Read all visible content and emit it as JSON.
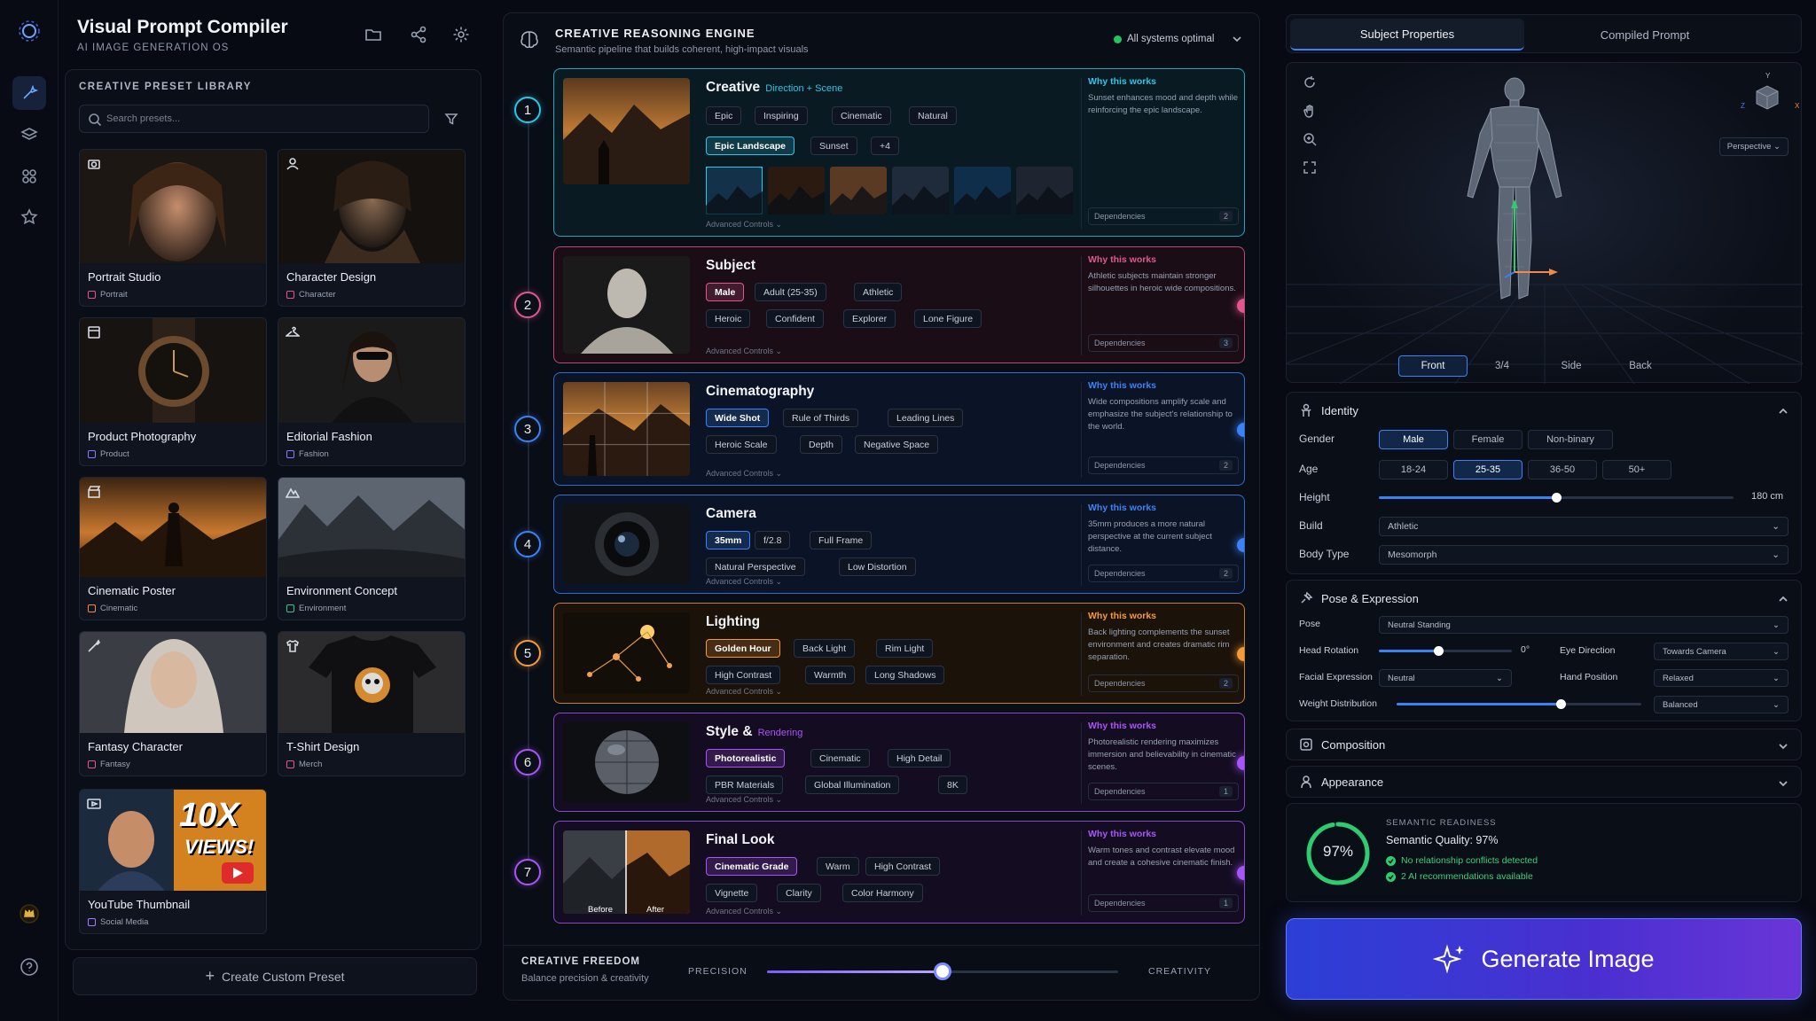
{
  "app": {
    "title": "Visual Prompt Compiler",
    "subtitle": "AI IMAGE GENERATION OS"
  },
  "library": {
    "title": "CREATIVE PRESET LIBRARY",
    "search_placeholder": "Search presets...",
    "create_label": "Create Custom Preset",
    "cards": [
      {
        "name": "Portrait Studio",
        "tag": "Portrait",
        "icon": "camera-icon",
        "tag_color": "#e0578f"
      },
      {
        "name": "Character Design",
        "tag": "Character",
        "icon": "user-icon",
        "tag_color": "#e0578f"
      },
      {
        "name": "Product Photography",
        "tag": "Product",
        "icon": "box-icon",
        "tag_color": "#8b7bff"
      },
      {
        "name": "Editorial Fashion",
        "tag": "Fashion",
        "icon": "hanger-icon",
        "tag_color": "#8b7bff"
      },
      {
        "name": "Cinematic Poster",
        "tag": "Cinematic",
        "icon": "clapper-icon",
        "tag_color": "#f08a4b"
      },
      {
        "name": "Environment Concept",
        "tag": "Environment",
        "icon": "mountain-icon",
        "tag_color": "#34c38f"
      },
      {
        "name": "Fantasy Character",
        "tag": "Fantasy",
        "icon": "wand-icon",
        "tag_color": "#e0578f"
      },
      {
        "name": "T-Shirt Design",
        "tag": "Merch",
        "icon": "shirt-icon",
        "tag_color": "#e0578f"
      },
      {
        "name": "YouTube Thumbnail",
        "tag": "Social Media",
        "icon": "play-icon",
        "tag_color": "#a77bff",
        "overlay1": "10X",
        "overlay2": "VIEWS!"
      }
    ]
  },
  "engine": {
    "title": "CREATIVE REASONING ENGINE",
    "subtitle": "Semantic pipeline that builds coherent, high-impact visuals",
    "status": "All systems optimal",
    "steps": [
      {
        "num": "1",
        "title": "Creative",
        "accent": "Direction + Scene",
        "color": "#2cc6e6",
        "chips_r1": [
          "Epic",
          "Inspiring",
          "Cinematic",
          "Natural"
        ],
        "chips_r2": [
          "Epic Landscape",
          "Sunset",
          "+4"
        ],
        "why_title": "Why this works",
        "why": "Sunset enhances mood and depth while reinforcing the epic landscape.",
        "deps_label": "Dependencies",
        "deps": "2",
        "adv": "Advanced Controls"
      },
      {
        "num": "2",
        "title": "Subject",
        "accent": "",
        "color": "#e0578f",
        "chips_r1": [
          "Male",
          "Adult (25-35)",
          "Athletic"
        ],
        "chips_r2": [
          "Heroic",
          "Confident",
          "Explorer",
          "Lone Figure"
        ],
        "why_title": "Why this works",
        "why": "Athletic subjects maintain stronger silhouettes in heroic wide compositions.",
        "deps_label": "Dependencies",
        "deps": "3",
        "adv": "Advanced Controls"
      },
      {
        "num": "3",
        "title": "Cinematography",
        "accent": "",
        "color": "#3b82f6",
        "chips_r1": [
          "Wide Shot",
          "Rule of Thirds",
          "Leading Lines"
        ],
        "chips_r2": [
          "Heroic Scale",
          "Depth",
          "Negative Space"
        ],
        "why_title": "Why this works",
        "why": "Wide compositions amplify scale and emphasize the subject's relationship to the world.",
        "deps_label": "Dependencies",
        "deps": "2",
        "adv": "Advanced Controls"
      },
      {
        "num": "4",
        "title": "Camera",
        "accent": "",
        "color": "#3b82f6",
        "chips_r1": [
          "35mm",
          "f/2.8",
          "Full Frame"
        ],
        "chips_r2": [
          "Natural Perspective",
          "Low Distortion"
        ],
        "why_title": "Why this works",
        "why": "35mm produces a more natural perspective at the current subject distance.",
        "deps_label": "Dependencies",
        "deps": "2",
        "adv": "Advanced Controls"
      },
      {
        "num": "5",
        "title": "Lighting",
        "accent": "",
        "color": "#f39a3b",
        "chips_r1": [
          "Golden Hour",
          "Back Light",
          "Rim Light"
        ],
        "chips_r2": [
          "High Contrast",
          "Warmth",
          "Long Shadows"
        ],
        "why_title": "Why this works",
        "why": "Back lighting complements the sunset environment and creates dramatic rim separation.",
        "deps_label": "Dependencies",
        "deps": "2",
        "adv": "Advanced Controls"
      },
      {
        "num": "6",
        "title": "Style &",
        "accent": "Rendering",
        "color": "#a855f7",
        "chips_r1": [
          "Photorealistic",
          "Cinematic",
          "High Detail"
        ],
        "chips_r2": [
          "PBR Materials",
          "Global Illumination",
          "8K"
        ],
        "why_title": "Why this works",
        "why": "Photorealistic rendering maximizes immersion and believability in cinematic scenes.",
        "deps_label": "Dependencies",
        "deps": "1",
        "adv": "Advanced Controls"
      },
      {
        "num": "7",
        "title": "Final Look",
        "accent": "",
        "color": "#a855f7",
        "chips_r1": [
          "Cinematic Grade",
          "Warm",
          "High Contrast"
        ],
        "chips_r2": [
          "Vignette",
          "Clarity",
          "Color Harmony"
        ],
        "why_title": "Why this works",
        "why": "Warm tones and contrast elevate mood and create a cohesive cinematic finish.",
        "deps_label": "Dependencies",
        "deps": "1",
        "adv": "Advanced Controls",
        "before": "Before",
        "after": "After"
      }
    ]
  },
  "freedom": {
    "title": "CREATIVE FREEDOM",
    "subtitle": "Balance precision & creativity",
    "left": "PRECISION",
    "right": "CREATIVITY",
    "value": 0.5
  },
  "right": {
    "tabs": [
      "Subject Properties",
      "Compiled Prompt"
    ],
    "views": [
      "Front",
      "3/4",
      "Side",
      "Back"
    ],
    "perspective": "Perspective",
    "axes": {
      "x": "X",
      "y": "Y",
      "z": "Z"
    },
    "identity": {
      "title": "Identity",
      "gender_label": "Gender",
      "genders": [
        "Male",
        "Female",
        "Non-binary"
      ],
      "age_label": "Age",
      "ages": [
        "18-24",
        "25-35",
        "36-50",
        "50+"
      ],
      "height_label": "Height",
      "height_value": "180 cm",
      "height_level": 0.5,
      "build_label": "Build",
      "build_value": "Athletic",
      "body_label": "Body Type",
      "body_value": "Mesomorph"
    },
    "pose": {
      "title": "Pose & Expression",
      "pose_label": "Pose",
      "pose_value": "Neutral Standing",
      "head_label": "Head Rotation",
      "head_value": "0°",
      "eye_label": "Eye Direction",
      "eye_value": "Towards Camera",
      "facial_label": "Facial Expression",
      "facial_value": "Neutral",
      "hand_label": "Hand Position",
      "hand_value": "Relaxed",
      "weight_label": "Weight Distribution",
      "weight_value": "Balanced"
    },
    "composition": "Composition",
    "appearance": "Appearance",
    "readiness": {
      "label": "SEMANTIC READINESS",
      "percent": "97%",
      "quality": "Semantic Quality: 97%",
      "check1": "No relationship conflicts detected",
      "check2": "2 AI recommendations available"
    },
    "generate": "Generate Image"
  }
}
